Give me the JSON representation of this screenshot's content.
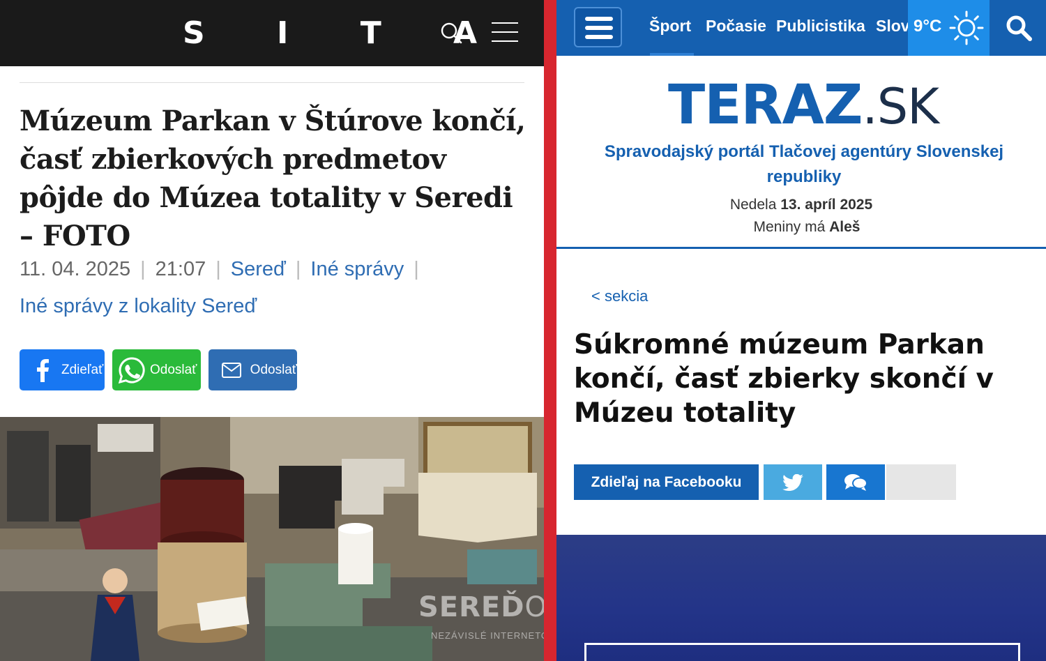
{
  "left": {
    "logo": "S I T A",
    "title": "Múzeum Parkan v Štúrove končí, časť zbierkových predmetov pôjde do Múzea totality v Seredi – FOTO",
    "meta": {
      "date": "11. 04. 2025",
      "time": "21:07",
      "location": "Sereď",
      "category": "Iné správy",
      "local_link": "Iné správy z lokality Sereď"
    },
    "share": {
      "facebook": "Zdieľať",
      "whatsapp": "Odoslať",
      "email": "Odoslať"
    },
    "watermark": {
      "brand_bold": "SEREĎ",
      "brand_light": "ONLINE",
      "sub": "NEZÁVISLÉ INTERNETOVÉ NOVINY"
    }
  },
  "right": {
    "nav": [
      "Šport",
      "Počasie",
      "Publicistika",
      "Slov"
    ],
    "weather": {
      "temp": "9°C",
      "icon": "sun-icon"
    },
    "logo_bold": "TERAZ",
    "logo_light": ".SK",
    "tagline": "Spravodajský portál Tlačovej agentúry Slovenskej republiky",
    "date_prefix": "Nedela",
    "date_value": "13. apríl 2025",
    "names_prefix": "Meniny má",
    "names_value": "Aleš",
    "back_link": "< sekcia",
    "title": "Súkromné múzeum Parkan končí, časť zbierky skončí v Múzeu totality",
    "share_facebook": "Zdieľaj na Facebooku"
  },
  "colors": {
    "sita_bar": "#1a1a1a",
    "divider": "#d7262f",
    "teraz_blue": "#1560b0",
    "facebook": "#1877f2",
    "whatsapp": "#2aba3a",
    "twitter": "#4aaae0"
  }
}
